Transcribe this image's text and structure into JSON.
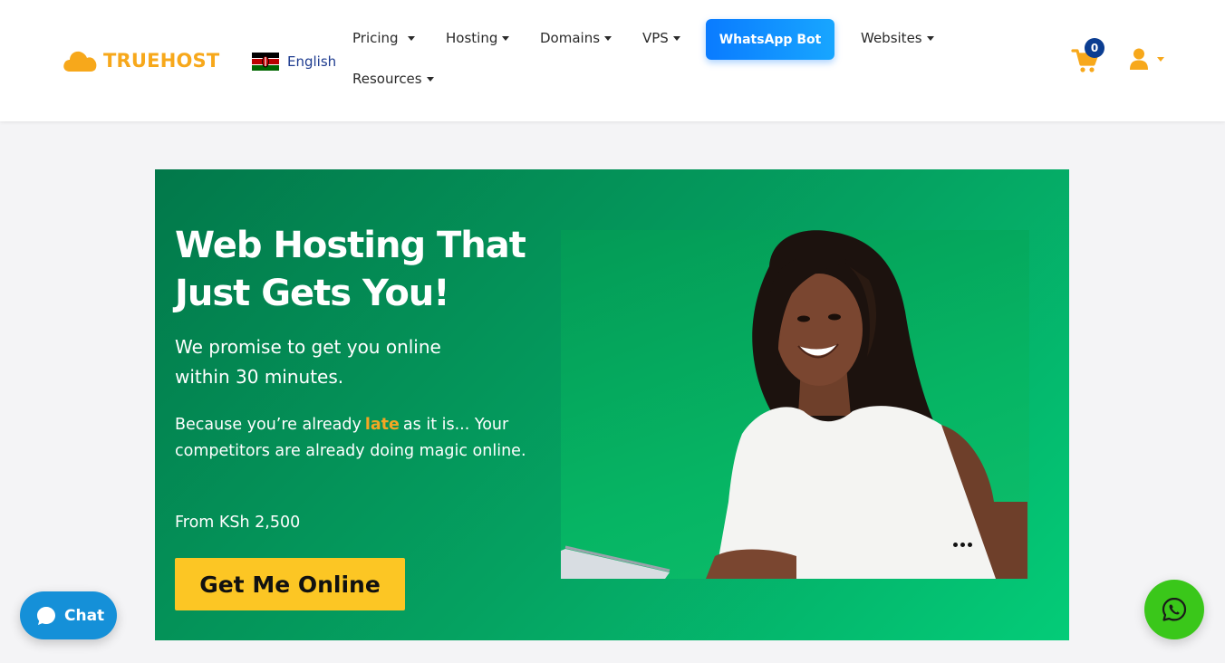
{
  "brand": {
    "name": "TRUEHOST"
  },
  "language": {
    "label": "English",
    "flag": "kenya-flag-icon"
  },
  "nav": {
    "pricing": "Pricing",
    "hosting": "Hosting",
    "domains": "Domains",
    "vps": "VPS",
    "whatsapp_bot": "WhatsApp Bot",
    "websites": "Websites",
    "resources": "Resources"
  },
  "cart": {
    "count": "0",
    "icon": "cart-icon"
  },
  "user": {
    "icon": "user-icon"
  },
  "hero": {
    "title": "Web Hosting That Just Gets You!",
    "promise": "We promise to get you online within 30 minutes.",
    "because_before": "Because you’re already",
    "because_highlight": "late",
    "because_after": "as it is... Your competitors are already doing magic online.",
    "price": "From KSh 2,500",
    "cta": "Get Me Online"
  },
  "chat": {
    "label": "Chat"
  },
  "colors": {
    "brand_orange": "#f7a81b",
    "hero_green": "#05a261",
    "cta_yellow": "#fcc624",
    "whatsapp_bot_blue": "#0a7bff",
    "chat_blue": "#1590d8",
    "whatsapp_green": "#3ac71a"
  }
}
